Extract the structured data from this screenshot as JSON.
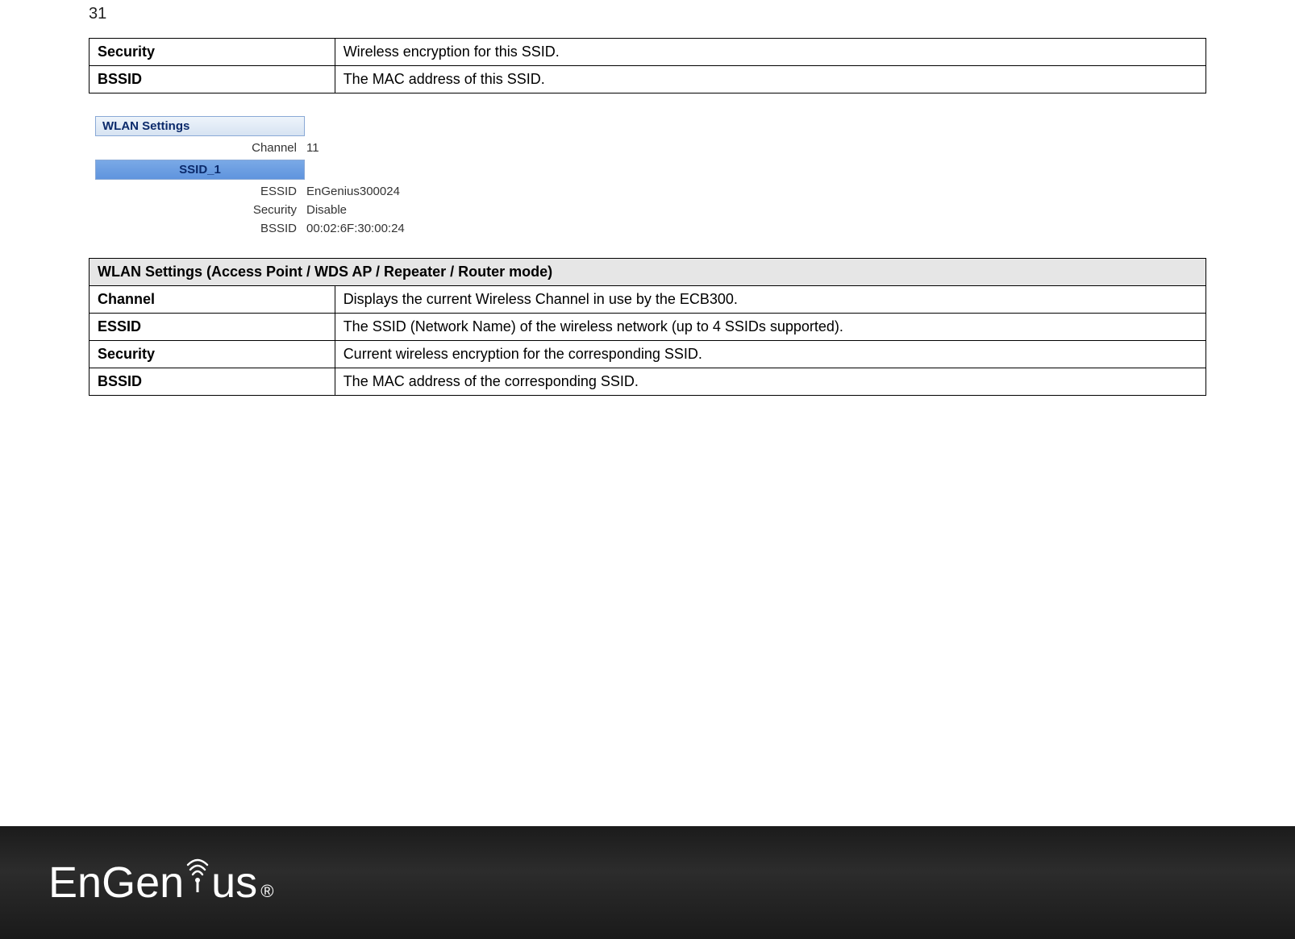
{
  "page_number": "31",
  "top_table": {
    "rows": [
      {
        "label": "Security",
        "desc": "Wireless encryption for this SSID."
      },
      {
        "label": "BSSID",
        "desc": "The MAC address of this SSID."
      }
    ]
  },
  "panel": {
    "title": "WLAN Settings",
    "channel_label": "Channel",
    "channel_value": "11",
    "ssid_tab": "SSID_1",
    "rows": [
      {
        "k": "ESSID",
        "v": "EnGenius300024"
      },
      {
        "k": "Security",
        "v": "Disable"
      },
      {
        "k": "BSSID",
        "v": "00:02:6F:30:00:24"
      }
    ]
  },
  "bottom_table": {
    "header": "WLAN Settings (Access Point / WDS AP / Repeater / Router mode)",
    "rows": [
      {
        "label": "Channel",
        "desc": "Displays the current Wireless Channel in use by the ECB300."
      },
      {
        "label": "ESSID",
        "desc": "The SSID (Network Name) of the wireless network (up to 4 SSIDs supported)."
      },
      {
        "label": "Security",
        "desc": "Current wireless encryption for the corresponding SSID."
      },
      {
        "label": "BSSID",
        "desc": "The MAC address of the corresponding SSID."
      }
    ]
  },
  "logo": {
    "text_en": "En",
    "text_gen": "Gen",
    "text_ius": "us",
    "registered": "®"
  }
}
